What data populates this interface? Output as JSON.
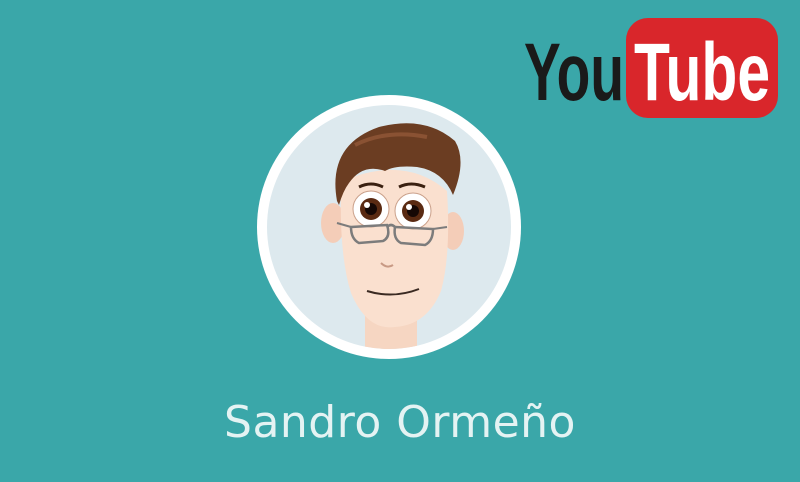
{
  "logo": {
    "word_left": "You",
    "word_right": "Tube",
    "icon": "youtube-logo",
    "colors": {
      "dark_text": "#1a1a1a",
      "red_box": "#d9262b",
      "light_text": "#ffffff"
    }
  },
  "avatar": {
    "icon": "cartoon-portrait",
    "colors": {
      "ring": "#ffffff",
      "inner_bg": "#dde9ee",
      "hair": "#6b3d22",
      "skin": "#fae0cf",
      "eyes": "#5a2a12"
    }
  },
  "channel": {
    "name": "Sandro Ormeño"
  },
  "colors": {
    "background": "#3aa7a9",
    "name_text": "#e4f3f3"
  }
}
